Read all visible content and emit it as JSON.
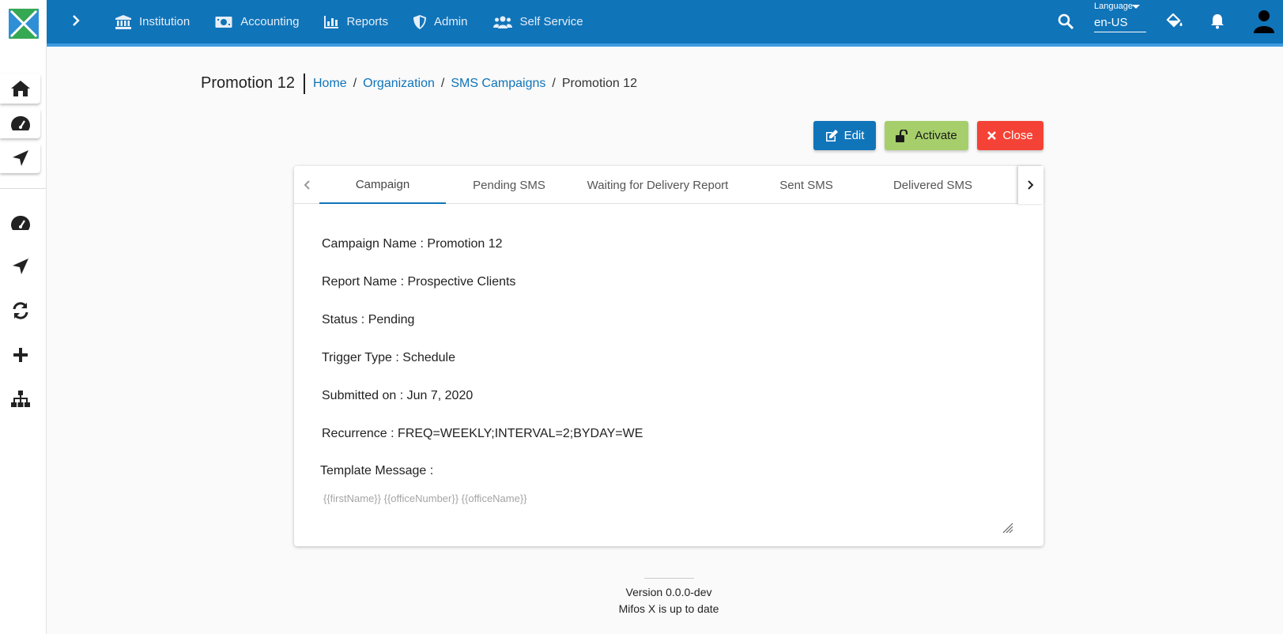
{
  "topbar": {
    "nav": [
      {
        "label": "Institution",
        "icon": "institution-icon"
      },
      {
        "label": "Accounting",
        "icon": "money-icon"
      },
      {
        "label": "Reports",
        "icon": "bar-chart-icon"
      },
      {
        "label": "Admin",
        "icon": "shield-icon"
      },
      {
        "label": "Self Service",
        "icon": "users-icon"
      }
    ],
    "language": {
      "label": "Language",
      "value": "en-US"
    }
  },
  "header": {
    "title": "Promotion 12",
    "breadcrumbs": [
      "Home",
      "Organization",
      "SMS Campaigns"
    ],
    "current": "Promotion 12",
    "separator": "/"
  },
  "actions": {
    "edit": "Edit",
    "activate": "Activate",
    "close": "Close"
  },
  "tabs": [
    "Campaign",
    "Pending SMS",
    "Waiting for Delivery Report",
    "Sent SMS",
    "Delivered SMS"
  ],
  "campaign": {
    "fields": [
      "Campaign Name : Promotion 12",
      "Report Name : Prospective Clients",
      "Status : Pending",
      "Trigger Type : Schedule",
      "Submitted on : Jun 7, 2020",
      "Recurrence : FREQ=WEEKLY;INTERVAL=2;BYDAY=WE"
    ],
    "template_label": "Template Message :",
    "template_text": "{{firstName}}  {{officeNumber}}  {{officeName}}"
  },
  "footer": {
    "version": "Version 0.0.0-dev",
    "status": "Mifos X is up to date"
  },
  "colors": {
    "primary": "#1074b9",
    "activate": "#a6cf6b",
    "close": "#f44336"
  }
}
